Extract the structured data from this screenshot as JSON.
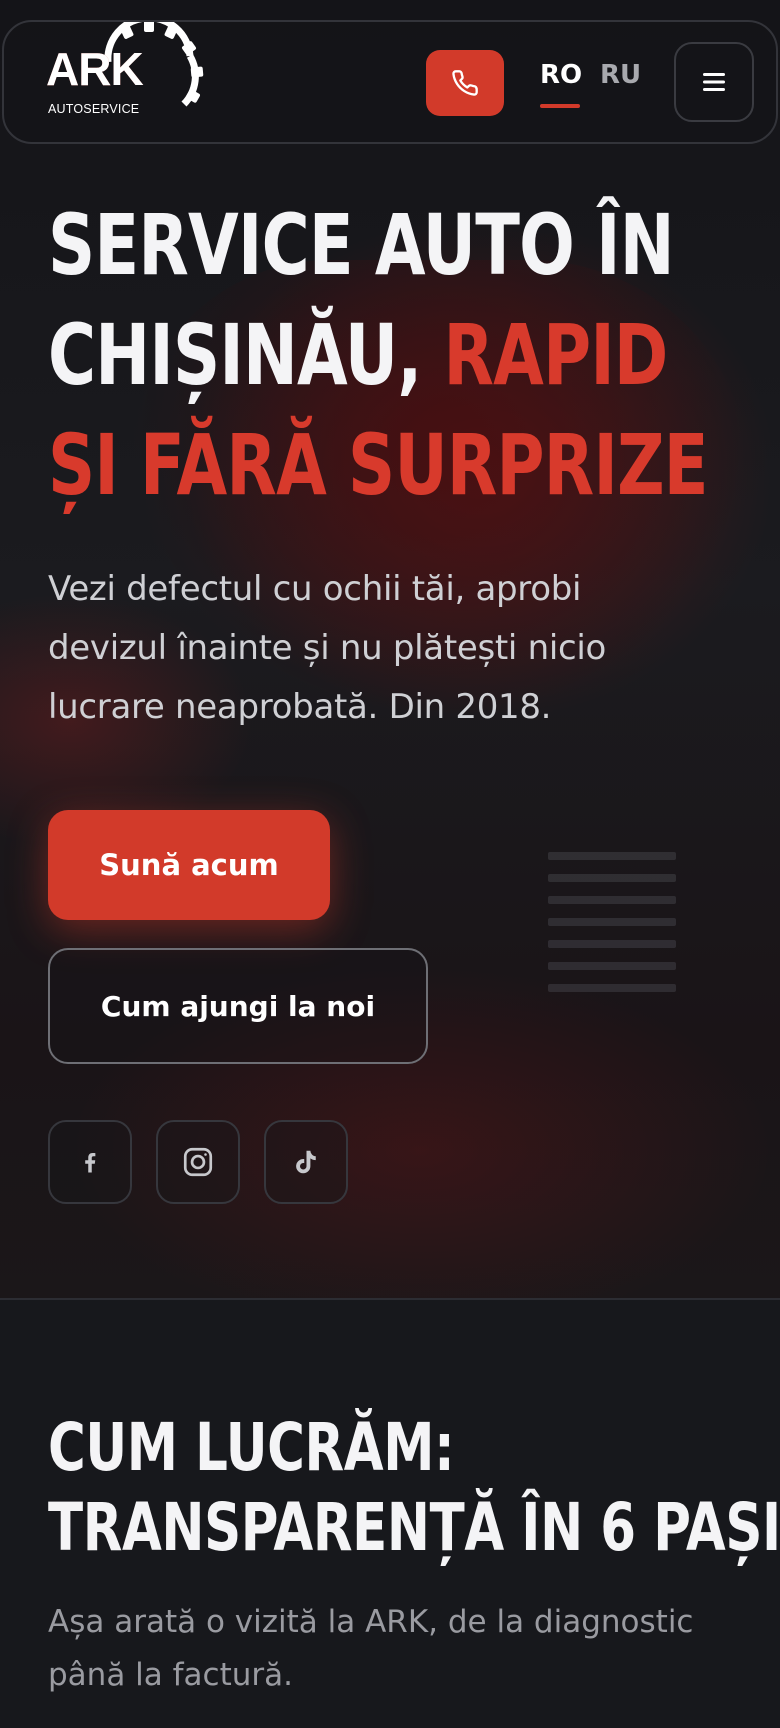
{
  "header": {
    "logo_text": "ARK",
    "logo_subtext": "AUTOSERVICE",
    "languages": [
      {
        "code": "RO",
        "active": true
      },
      {
        "code": "RU",
        "active": false
      }
    ],
    "call_icon": "phone-icon",
    "menu_icon": "menu-icon"
  },
  "hero": {
    "title_line1": "SERVICE AUTO ÎN",
    "title_line2_a": "CHIȘINĂU, ",
    "title_line2_b": "RAPID",
    "title_line3": "ȘI FĂRĂ SURPRIZE",
    "subtitle": "Vezi defectul cu ochii tăi, aprobi devizul înainte și nu plătești nicio lucrare neaprobată. Din 2018.",
    "primary_button": "Sună acum",
    "secondary_button": "Cum ajungi la noi",
    "social": [
      {
        "icon": "facebook-icon"
      },
      {
        "icon": "instagram-icon"
      },
      {
        "icon": "tiktok-icon"
      }
    ]
  },
  "section_process": {
    "title_line1": "CUM LUCRĂM:",
    "title_line2": "TRANSPARENȚĂ ÎN 6 PAȘI",
    "subtitle": "Așa arată o vizită la ARK, de la diagnostic până la factură."
  },
  "colors": {
    "accent": "#d23a2a",
    "background": "#17181c",
    "text": "#f4f4f6",
    "muted": "#9a9ba1"
  }
}
